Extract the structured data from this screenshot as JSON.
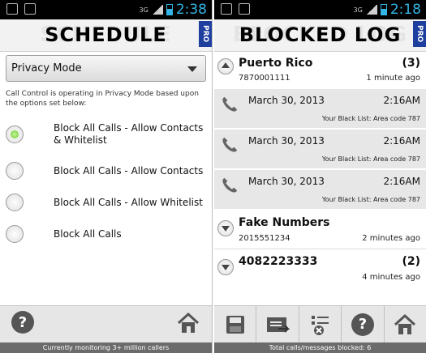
{
  "status": {
    "left_screen_time": "2:38",
    "right_screen_time": "2:18",
    "network": "3G"
  },
  "schedule": {
    "title": "SCHEDULE",
    "pro_badge": "PRO",
    "mode_select": {
      "value": "Privacy Mode"
    },
    "description": "Call Control is operating in Privacy Mode based upon the options set below:",
    "options": [
      {
        "label": "Block All Calls - Allow Contacts & Whitelist",
        "selected": true
      },
      {
        "label": "Block All Calls - Allow Contacts",
        "selected": false
      },
      {
        "label": "Block All Calls - Allow Whitelist",
        "selected": false
      },
      {
        "label": "Block All Calls",
        "selected": false
      }
    ],
    "footer": "Currently monitoring 3+ million callers",
    "icons": {
      "help": "?",
      "home": "home-icon"
    }
  },
  "blocked_log": {
    "title": "BLOCKED LOG",
    "pro_badge": "PRO",
    "groups": [
      {
        "name": "Puerto Rico",
        "count": "(3)",
        "number": "7870001111",
        "time": "1 minute ago",
        "expanded": true,
        "entries": [
          {
            "date": "March 30, 2013",
            "time": "2:16AM",
            "reason": "Your Black List: Area code 787"
          },
          {
            "date": "March 30, 2013",
            "time": "2:16AM",
            "reason": "Your Black List: Area code 787"
          },
          {
            "date": "March 30, 2013",
            "time": "2:16AM",
            "reason": "Your Black List: Area code 787"
          }
        ]
      },
      {
        "name": "Fake Numbers",
        "count": "",
        "number": "2015551234",
        "time": "2 minutes ago",
        "expanded": false
      },
      {
        "name": "4082223333",
        "count": "(2)",
        "number": "",
        "time": "4 minutes ago",
        "expanded": false
      }
    ],
    "footer": "Total calls/messages blocked: 6",
    "toolbar_icons": [
      "save-icon",
      "export-icon",
      "clear-list-icon",
      "help-icon",
      "home-icon"
    ]
  }
}
